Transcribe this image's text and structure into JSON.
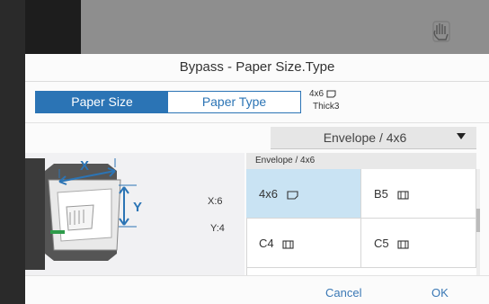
{
  "dialog": {
    "title": "Bypass - Paper Size.Type"
  },
  "tabs": {
    "paper_size": "Paper Size",
    "paper_type": "Paper Type"
  },
  "current_setting": {
    "size": "4x6",
    "type": "Thick3"
  },
  "dropdown": {
    "selected": "Envelope / 4x6"
  },
  "illustration": {
    "x_axis_label": "X",
    "y_axis_label": "Y",
    "x_value": "X:6",
    "y_value": "Y:4"
  },
  "list": {
    "header": "Envelope / 4x6",
    "items": [
      {
        "label": "4x6",
        "icon": "portrait-paper-icon",
        "selected": true
      },
      {
        "label": "B5",
        "icon": "landscape-paper-icon",
        "selected": false
      },
      {
        "label": "C4",
        "icon": "landscape-paper-icon",
        "selected": false
      },
      {
        "label": "C5",
        "icon": "landscape-paper-icon",
        "selected": false
      }
    ]
  },
  "footer": {
    "cancel_label": "Cancel",
    "ok_label": "OK"
  },
  "colors": {
    "accent": "#2b74b5",
    "selected_cell": "#c9e3f3"
  }
}
